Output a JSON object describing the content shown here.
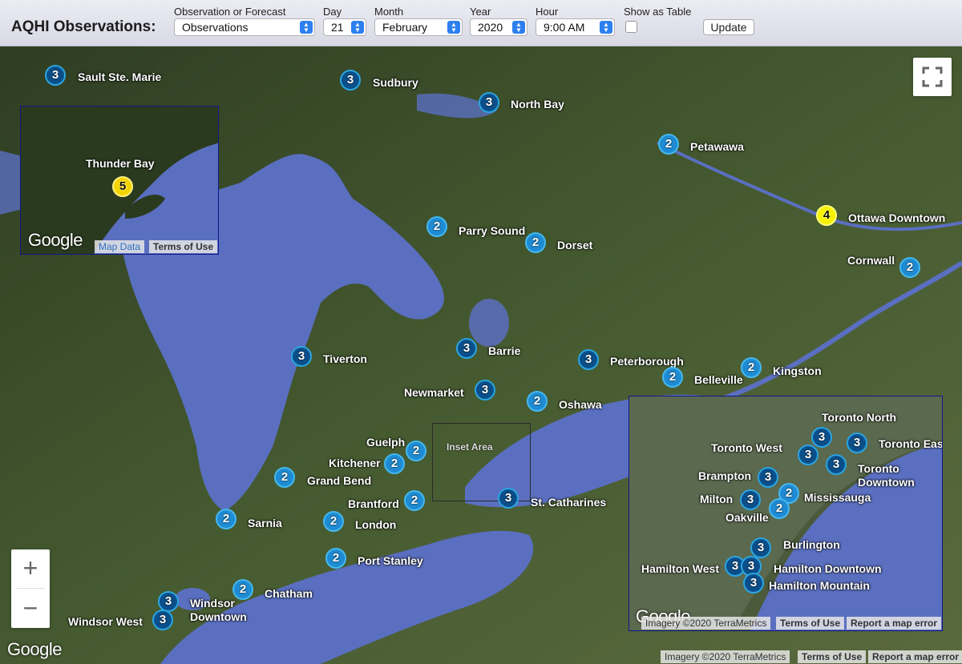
{
  "toolbar": {
    "title": "AQHI Observations:",
    "obs_forecast": {
      "label": "Observation or Forecast",
      "value": "Observations"
    },
    "day": {
      "label": "Day",
      "value": "21"
    },
    "month": {
      "label": "Month",
      "value": "February"
    },
    "year": {
      "label": "Year",
      "value": "2020"
    },
    "hour": {
      "label": "Hour",
      "value": "9:00 AM"
    },
    "show_table": {
      "label": "Show as Table"
    },
    "update_label": "Update"
  },
  "map": {
    "inset_area_label": "Inset Area",
    "zoom_in": "+",
    "zoom_out": "−",
    "google": "Google",
    "imagery": "Imagery ©2020 TerraMetrics",
    "terms": "Terms of Use",
    "report": "Report a map error",
    "thunder_inset": {
      "map_data": "Map Data",
      "terms": "Terms of Use",
      "google": "Google"
    },
    "toronto_inset": {
      "imagery": "Imagery ©2020 TerraMetrics",
      "terms": "Terms of Use",
      "report": "Report a map error",
      "google": "Google"
    }
  },
  "stations": [
    {
      "name": "Sault Ste. Marie",
      "value": "3"
    },
    {
      "name": "Sudbury",
      "value": "3"
    },
    {
      "name": "North Bay",
      "value": "3"
    },
    {
      "name": "Petawawa",
      "value": "2"
    },
    {
      "name": "Ottawa Downtown",
      "value": "4"
    },
    {
      "name": "Cornwall",
      "value": "2"
    },
    {
      "name": "Parry Sound",
      "value": "2"
    },
    {
      "name": "Dorset",
      "value": "2"
    },
    {
      "name": "Tiverton",
      "value": "3"
    },
    {
      "name": "Barrie",
      "value": "3"
    },
    {
      "name": "Peterborough",
      "value": "3"
    },
    {
      "name": "Kingston",
      "value": "2"
    },
    {
      "name": "Belleville",
      "value": "2"
    },
    {
      "name": "Newmarket",
      "value": "3"
    },
    {
      "name": "Oshawa",
      "value": "2"
    },
    {
      "name": "Guelph",
      "value": "2"
    },
    {
      "name": "Kitchener",
      "value": "2"
    },
    {
      "name": "Grand Bend",
      "value": "2"
    },
    {
      "name": "Brantford",
      "value": "2"
    },
    {
      "name": "St. Catharines",
      "value": "3"
    },
    {
      "name": "Sarnia",
      "value": "2"
    },
    {
      "name": "London",
      "value": "2"
    },
    {
      "name": "Port Stanley",
      "value": "2"
    },
    {
      "name": "Chatham",
      "value": "2"
    },
    {
      "name": "Windsor Downtown",
      "value": "3"
    },
    {
      "name": "Windsor West",
      "value": "3"
    },
    {
      "name": "Thunder Bay",
      "value": "5"
    }
  ],
  "toronto_stations": [
    {
      "name": "Toronto North",
      "value": "3"
    },
    {
      "name": "Toronto West",
      "value": "3"
    },
    {
      "name": "Toronto East",
      "value": "3"
    },
    {
      "name": "Toronto Downtown",
      "value": "3"
    },
    {
      "name": "Brampton",
      "value": "3"
    },
    {
      "name": "Milton",
      "value": "3"
    },
    {
      "name": "Mississauga",
      "value": "2"
    },
    {
      "name": "Oakville",
      "value": "2"
    },
    {
      "name": "Burlington",
      "value": "3"
    },
    {
      "name": "Hamilton West",
      "value": "3"
    },
    {
      "name": "Hamilton Downtown",
      "value": "3"
    },
    {
      "name": "Hamilton Mountain",
      "value": "3"
    }
  ],
  "colors": {
    "water": "#5a6fc0",
    "land": "#3d4f2c",
    "marker3": "#0b4f8a",
    "marker2": "#1f8bd3",
    "marker4": "#f7f200",
    "inset_border": "#12168a"
  }
}
